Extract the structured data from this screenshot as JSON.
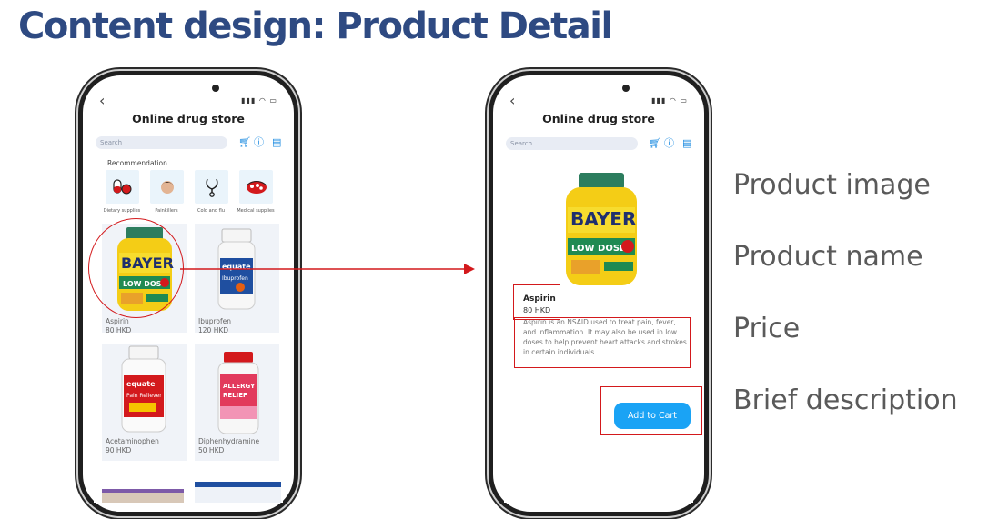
{
  "slide": {
    "title": "Content design: Product Detail"
  },
  "app": {
    "title": "Online drug store",
    "back_glyph": "‹",
    "search_placeholder": "Search",
    "status_glyphs": "▮▮▮ ◠ ▭"
  },
  "home": {
    "recommendation_label": "Recommendation",
    "categories": [
      {
        "label": "Dietary supplies",
        "icon": "pills-icon"
      },
      {
        "label": "Painkillers",
        "icon": "head-icon"
      },
      {
        "label": "Cold and flu",
        "icon": "stethoscope-icon"
      },
      {
        "label": "Medical supplies",
        "icon": "first-aid-icon"
      }
    ],
    "products": [
      {
        "name": "Aspirin",
        "price": "80 HKD"
      },
      {
        "name": "Ibuprofen",
        "price": "120 HKD"
      },
      {
        "name": "Acetaminophen",
        "price": "90 HKD"
      },
      {
        "name": "Diphenhydramine",
        "price": "50 HKD"
      }
    ]
  },
  "detail": {
    "name": "Aspirin",
    "price": "80 HKD",
    "description": "Aspirin is an NSAID used to treat pain, fever, and inflammation. It may also be used in low doses to help prevent heart attacks and strokes in certain individuals.",
    "cta": "Add to Cart"
  },
  "annotations": {
    "product_image": "Product image",
    "product_name": "Product name",
    "price": "Price",
    "brief_description": "Brief description"
  },
  "colors": {
    "title_blue": "#2e4a82",
    "accent_blue": "#1aa3f5",
    "annotation_red": "#d3191c"
  }
}
